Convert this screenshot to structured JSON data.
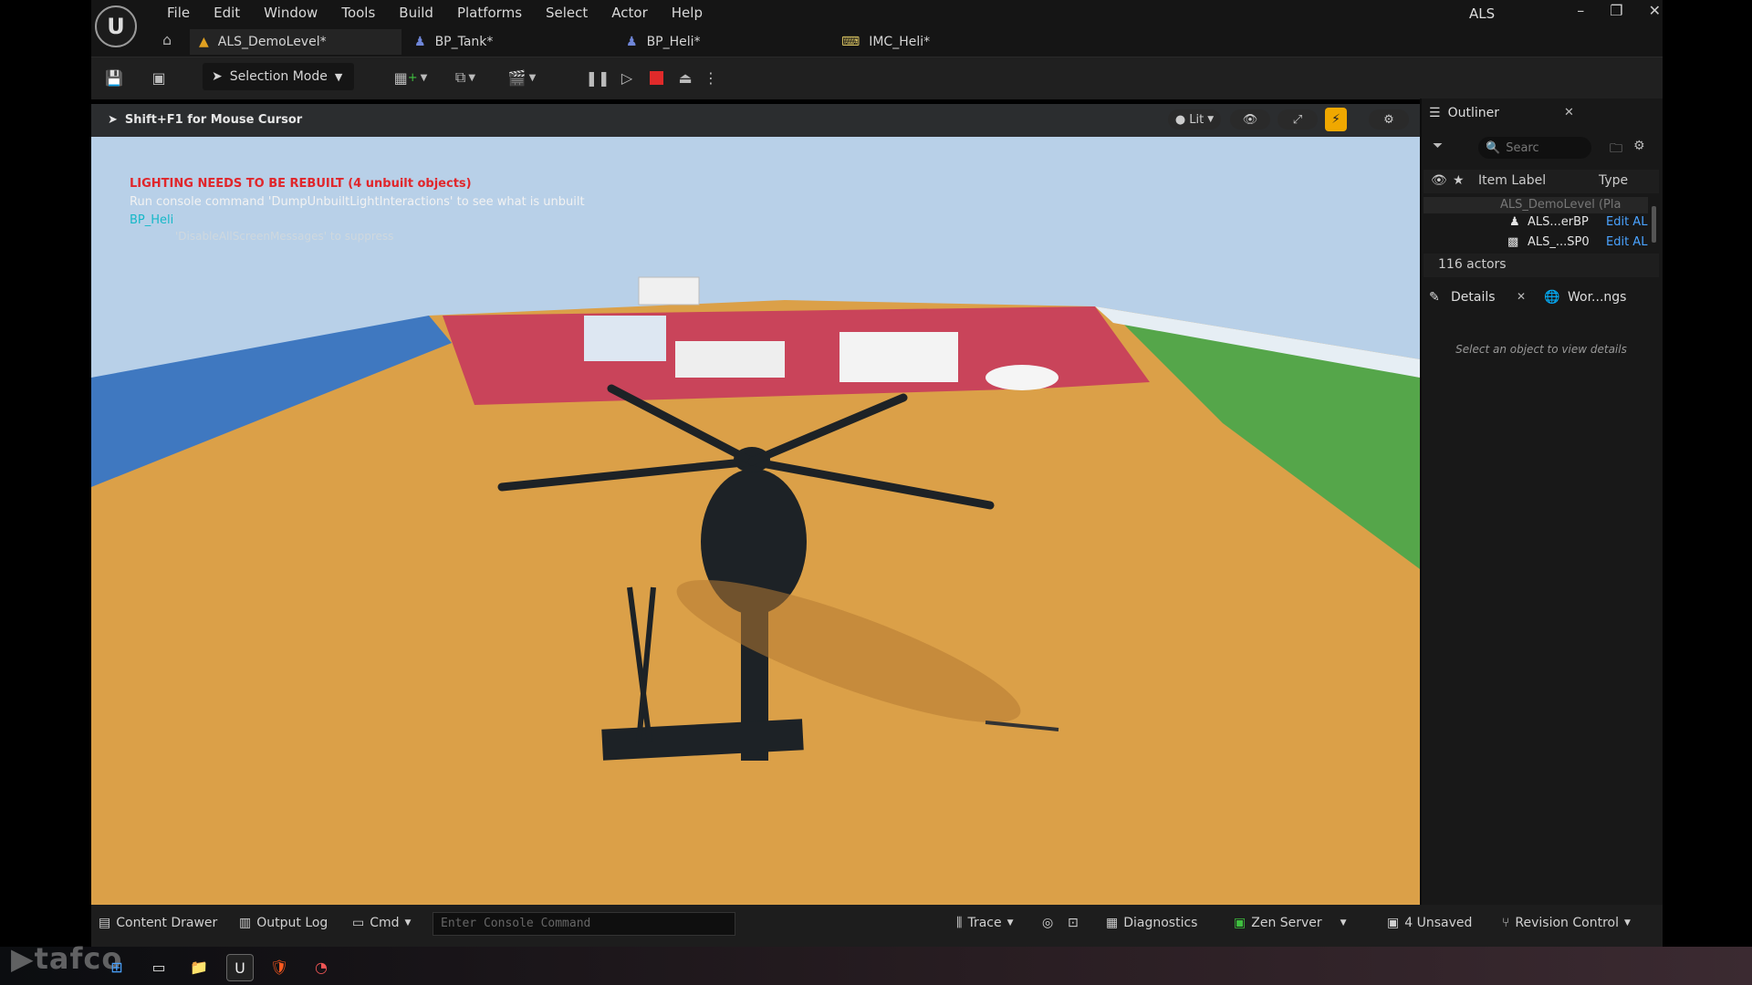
{
  "app": {
    "title": "ALS",
    "logo": "U"
  },
  "menu": [
    "File",
    "Edit",
    "Window",
    "Tools",
    "Build",
    "Platforms",
    "Select",
    "Actor",
    "Help"
  ],
  "tabs": [
    {
      "label": "ALS_DemoLevel*",
      "icon": "level-icon"
    },
    {
      "label": "BP_Tank*",
      "icon": "blueprint-icon"
    },
    {
      "label": "BP_Heli*",
      "icon": "blueprint-icon"
    },
    {
      "label": "IMC_Heli*",
      "icon": "input-mapping-icon"
    }
  ],
  "toolbar": {
    "selection_mode": "Selection Mode"
  },
  "viewport": {
    "hint": "Shift+F1 for Mouse Cursor",
    "view_mode": "Lit",
    "messages": {
      "warning": "LIGHTING NEEDS TO BE REBUILT (4 unbuilt objects)",
      "info": "Run console command 'DumpUnbuiltLightInteractions' to see what is unbuilt",
      "actor": "BP_Heli",
      "suppress": "'DisableAllScreenMessages' to suppress"
    }
  },
  "outliner": {
    "title": "Outliner",
    "search_placeholder": "Searc",
    "col_label": "Item Label",
    "col_type": "Type",
    "rows": [
      {
        "label": "ALS_DemoLevel (Pla",
        "type": ""
      },
      {
        "label": "ALS...erBP",
        "type": "Edit AL"
      },
      {
        "label": "ALS_...SP0",
        "type": "Edit AL"
      }
    ],
    "count": "116 actors"
  },
  "details": {
    "tab": "Details",
    "world_tab": "Wor...ngs",
    "empty": "Select an object to view details"
  },
  "statusbar": {
    "content_drawer": "Content Drawer",
    "output_log": "Output Log",
    "cmd": "Cmd",
    "console_placeholder": "Enter Console Command",
    "trace": "Trace",
    "diagnostics": "Diagnostics",
    "zen": "Zen Server",
    "unsaved": "4 Unsaved",
    "revision": "Revision Control"
  },
  "taskbar": {
    "watermark": "tafco"
  },
  "colors": {
    "warning": "#e0262b",
    "accent": "#f0a800",
    "stop": "#e02a2a",
    "link": "#4aa3ff",
    "ground": "#dba048"
  }
}
